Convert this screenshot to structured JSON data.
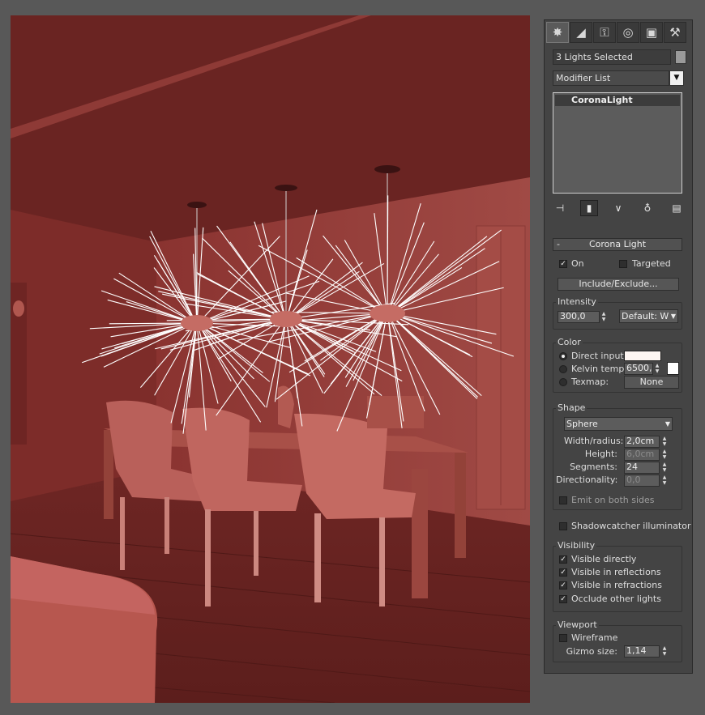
{
  "viewport": {
    "description_icon": "dining-room-scene",
    "colors": {
      "background": "#7a2c2a",
      "light_rays": "#ffffff"
    }
  },
  "command_panel": {
    "tabs": [
      {
        "icon": "create-icon",
        "glyph": "✸"
      },
      {
        "icon": "modify-icon",
        "glyph": "◢"
      },
      {
        "icon": "hierarchy-icon",
        "glyph": "⚿"
      },
      {
        "icon": "motion-icon",
        "glyph": "◎"
      },
      {
        "icon": "display-icon",
        "glyph": "▣"
      },
      {
        "icon": "utilities-icon",
        "glyph": "⚒"
      }
    ],
    "selection_name": "3 Lights Selected",
    "modifier_list": "Modifier List",
    "stack_item": "CoronaLight"
  },
  "rollout": {
    "title": "Corona Light",
    "collapse": "-",
    "on_label": "On",
    "on_checked": true,
    "targeted_label": "Targeted",
    "targeted_checked": false,
    "include_exclude": "Include/Exclude...",
    "intensity": {
      "label": "Intensity",
      "value": "300,0",
      "unit_select": "Default: W"
    },
    "color": {
      "label": "Color",
      "direct_input": "Direct input:",
      "direct_color": "#fdf6f2",
      "kelvin_label": "Kelvin temp:",
      "kelvin_value": "6500,0",
      "kelvin_color": "#ffffff",
      "texmap_label": "Texmap:",
      "texmap_button": "None",
      "selected": "direct_input"
    },
    "shape": {
      "label": "Shape",
      "type": "Sphere",
      "width_label": "Width/radius:",
      "width_value": "2,0cm",
      "height_label": "Height:",
      "height_value": "6,0cm",
      "segments_label": "Segments:",
      "segments_value": "24",
      "directionality_label": "Directionality:",
      "directionality_value": "0,0",
      "emit_both_label": "Emit on both sides",
      "emit_both_checked": false
    },
    "shadowcatcher_label": "Shadowcatcher illuminator",
    "shadowcatcher_checked": false,
    "visibility": {
      "label": "Visibility",
      "items": [
        {
          "label": "Visible directly",
          "checked": true
        },
        {
          "label": "Visible in reflections",
          "checked": true
        },
        {
          "label": "Visible in refractions",
          "checked": true
        },
        {
          "label": "Occlude other lights",
          "checked": true
        }
      ]
    },
    "viewport_group": {
      "label": "Viewport",
      "wireframe_label": "Wireframe",
      "wireframe_checked": false,
      "gizmo_label": "Gizmo size:",
      "gizmo_value": "1,14"
    }
  },
  "check_glyph": "✓",
  "spinner_glyph": "▲▼",
  "dropdown_glyph": "▼"
}
